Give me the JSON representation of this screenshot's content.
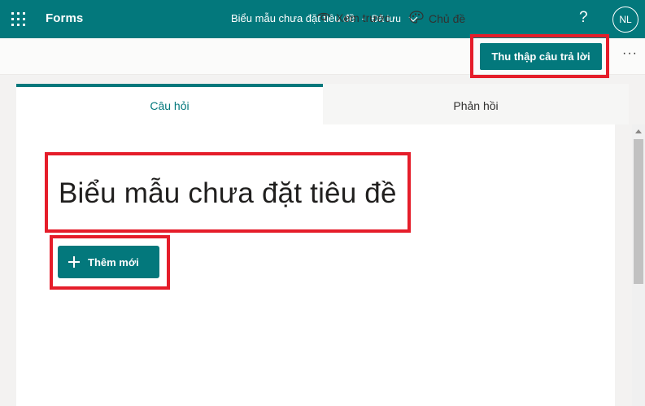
{
  "header": {
    "app_name": "Forms",
    "doc_title": "Biểu mẫu chưa đặt tiêu đề",
    "separator": "-",
    "save_status": "Đã lưu",
    "help_label": "?",
    "avatar_initials": "NL"
  },
  "commandbar": {
    "preview_label": "Xem trước",
    "theme_label": "Chủ đề",
    "collect_label": "Thu thập câu trả lời",
    "more_label": "···"
  },
  "tabs": [
    {
      "label": "Câu hỏi",
      "active": true
    },
    {
      "label": "Phản hồi",
      "active": false
    }
  ],
  "form": {
    "title": "Biểu mẫu chưa đặt tiêu đề",
    "add_new_label": "Thêm mới"
  },
  "colors": {
    "brand": "#03787c",
    "highlight": "#e51d2a"
  },
  "icons": [
    "waffle-icon",
    "chevron-down-icon",
    "eye-icon",
    "palette-icon",
    "plus-icon",
    "more-icon"
  ]
}
